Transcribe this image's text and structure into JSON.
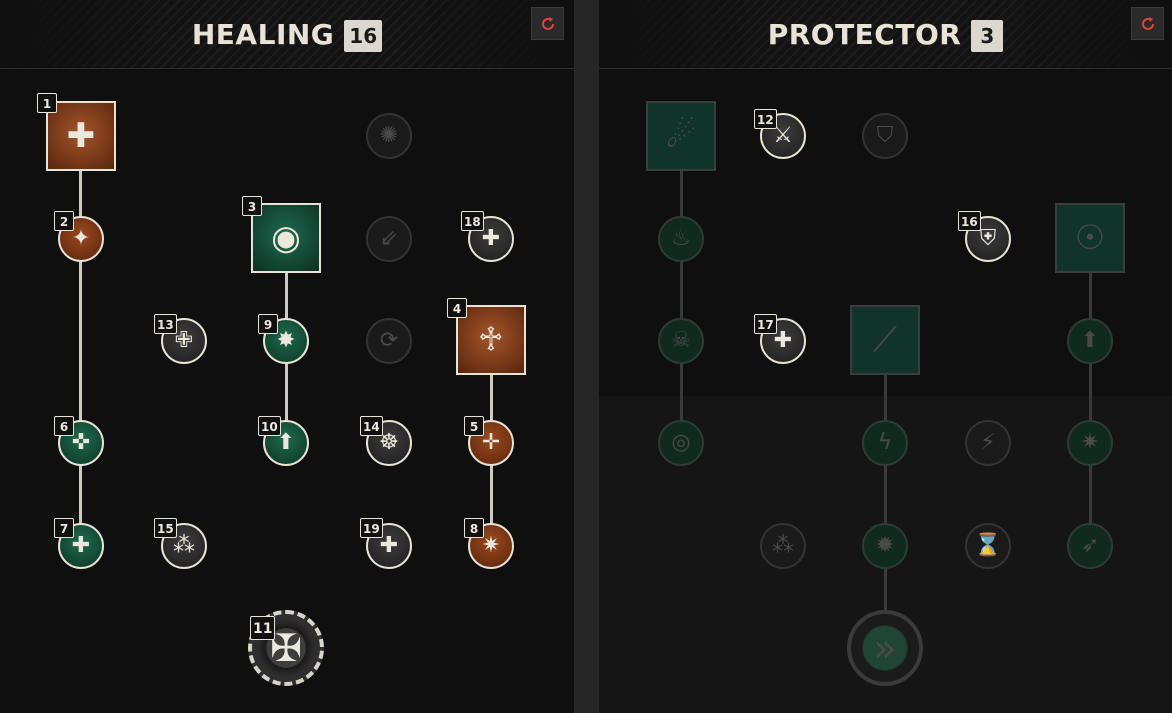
{
  "panels": {
    "healing": {
      "title": "HEALING",
      "count": "16"
    },
    "protector": {
      "title": "PROTECTOR",
      "count": "3"
    }
  },
  "icons": {
    "reset": "refresh-icon",
    "healing": [
      "cross-burst-icon",
      "sparkle-icon",
      "orb-icon",
      "cross-icon",
      "group-heal-icon",
      "plus-small-icon",
      "medic-cross-icon",
      "green-cross-icon",
      "burst-icon",
      "cross-star-icon",
      "arrow-up-icon",
      "double-arrow-icon",
      "cycle-icon",
      "swirl-icon"
    ],
    "protector": [
      "meteor-icon",
      "runner-icon",
      "shield-icon",
      "armor-icon",
      "silhouette-icon",
      "flame-icon",
      "skull-icon",
      "plus-cross-icon",
      "slash-icon",
      "lightning-icon",
      "sprint-icon",
      "ring-icon",
      "hourglass-icon",
      "explosion-icon",
      "chevron-shield-icon"
    ]
  },
  "badges": {
    "n1": "1",
    "n2": "2",
    "n3": "3",
    "n4": "4",
    "n5": "5",
    "n6": "6",
    "n7": "7",
    "n8": "8",
    "n9": "9",
    "n10": "10",
    "n11": "11",
    "n12": "12",
    "n13": "13",
    "n14": "14",
    "n15": "15",
    "n16": "16",
    "n17": "17",
    "n18": "18",
    "n19": "19"
  },
  "colors": {
    "healing_brown": "#8a3f18",
    "healing_green": "#1b5c43",
    "badge_bg": "#dcd8cf",
    "reset_accent": "#e0443a"
  }
}
